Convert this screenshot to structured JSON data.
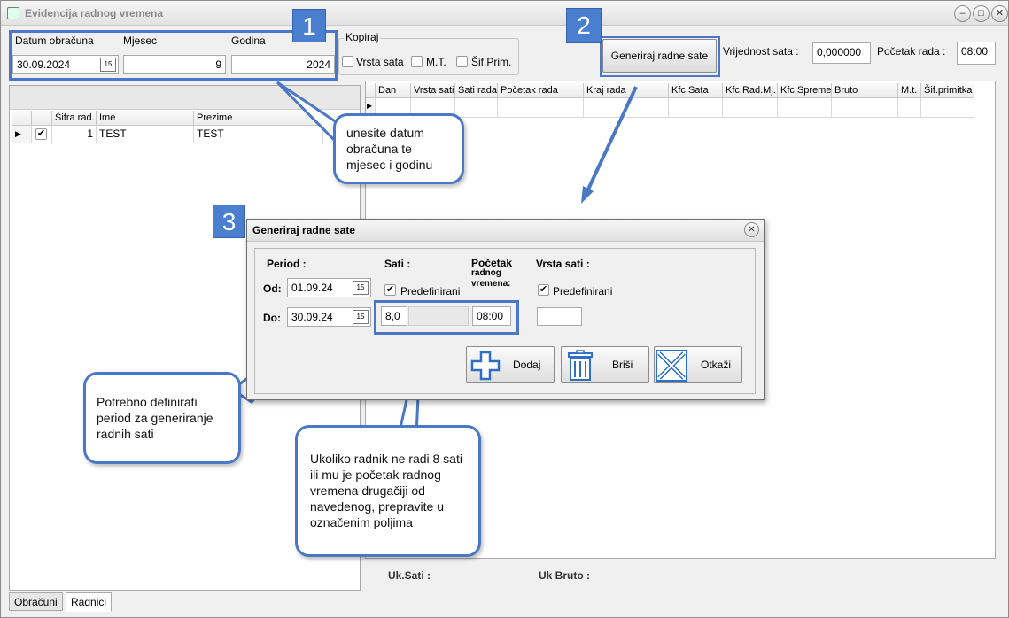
{
  "window": {
    "title": "Evidencija radnog vremena"
  },
  "header": {
    "datum_label": "Datum obračuna",
    "datum_value": "30.09.2024",
    "mjesec_label": "Mjesec",
    "mjesec_value": "9",
    "godina_label": "Godina",
    "godina_value": "2024",
    "kopiraj_label": "Kopiraj",
    "kopiraj_options": [
      "Vrsta sata",
      "M.T.",
      "Šif.Prim."
    ],
    "generate_button": "Generiraj radne sate",
    "vrijednost_label": "Vrijednost sata :",
    "vrijednost_value": "0,000000",
    "pocetak_label": "Početak rada :",
    "pocetak_value": "08:00"
  },
  "workers_table": {
    "columns": [
      "Šifra rad.",
      "Ime",
      "Prezime"
    ],
    "rows": [
      {
        "checked": true,
        "sifra": "1",
        "ime": "TEST",
        "prezime": "TEST"
      }
    ]
  },
  "hours_table": {
    "columns": [
      "Dan",
      "Vrsta sati",
      "Sati rada",
      "Početak rada",
      "Kraj rada",
      "Kfc.Sata",
      "Kfc.Rad.Mj.",
      "Kfc.Spreme",
      "Bruto",
      "M.t.",
      "Šif.primitka"
    ]
  },
  "footer": {
    "uk_sati_label": "Uk.Sati :",
    "uk_bruto_label": "Uk Bruto :"
  },
  "tabs": [
    "Obračuni",
    "Radnici"
  ],
  "dialog": {
    "title": "Generiraj radne sate",
    "period_label": "Period :",
    "od_label": "Od:",
    "od_value": "01.09.24",
    "do_label": "Do:",
    "do_value": "30.09.24",
    "sati_label": "Sati :",
    "sati_checkbox": "Predefinirani",
    "sati_value": "8,0",
    "pocetak_label_l1": "Početak",
    "pocetak_label_l2": "radnog",
    "pocetak_label_l3": "vremena:",
    "pocetak_value": "08:00",
    "vrsta_label": "Vrsta sati :",
    "vrsta_checkbox": "Predefinirani",
    "vrsta_value": "",
    "dodaj_button": "Dodaj",
    "brisi_button": "Briši",
    "otkazi_button": "Otkaži"
  },
  "annotations": {
    "badge1": "1",
    "badge2": "2",
    "badge3": "3",
    "callout1": "unesite datum obračuna te mjesec i godinu",
    "callout2": "Potrebno definirati period za generiranje radnih sati",
    "callout3": "Ukoliko radnik ne radi 8 sati ili mu je početak radnog vremena drugačiji od navedenog, prepravite u označenim poljima"
  },
  "colors": {
    "accent": "#4a78c4",
    "badge": "#4a7fd0"
  }
}
